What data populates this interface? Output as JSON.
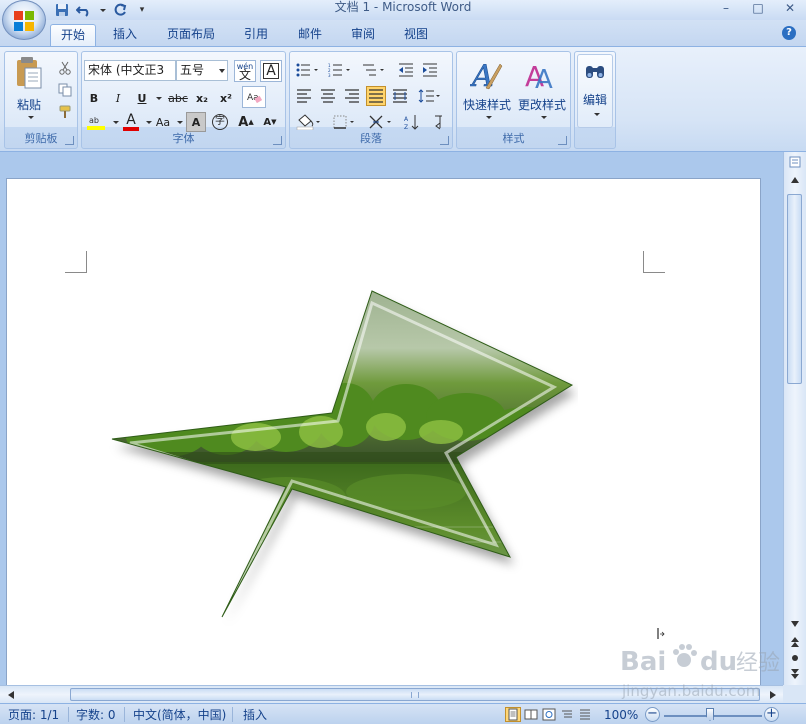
{
  "window": {
    "title": "文档 1 - Microsoft Word",
    "minimize": "–",
    "maximize": "□",
    "close": "✕"
  },
  "tabs": [
    "开始",
    "插入",
    "页面布局",
    "引用",
    "邮件",
    "审阅",
    "视图"
  ],
  "active_tab": "开始",
  "ribbon": {
    "clipboard": {
      "label": "剪贴板",
      "paste_label": "粘贴"
    },
    "font": {
      "label": "字体",
      "font_name": "宋体 (中文正3",
      "font_size": "五号",
      "phonetic_glyph": "wén",
      "bold": "B",
      "italic": "I",
      "underline": "U",
      "strike": "abc",
      "subscript": "x₂",
      "superscript": "x²",
      "change_case": "Aa",
      "grow": "A",
      "shrink": "A",
      "highlight_color": "#ffff00",
      "font_color": "#e00000"
    },
    "paragraph": {
      "label": "段落"
    },
    "styles": {
      "label": "样式",
      "quick_styles": "快速样式",
      "change_styles": "更改样式"
    },
    "editing": {
      "label": "编辑",
      "edit_label": "编辑"
    }
  },
  "statusbar": {
    "page": "页面: 1/1",
    "words": "字数: 0",
    "language": "中文(简体，中国)",
    "mode": "插入",
    "zoom": "100%"
  },
  "watermark": {
    "brand": "Bai",
    "brand_tail": "du",
    "cn": "经验",
    "url": "jingyan.baidu.com"
  }
}
